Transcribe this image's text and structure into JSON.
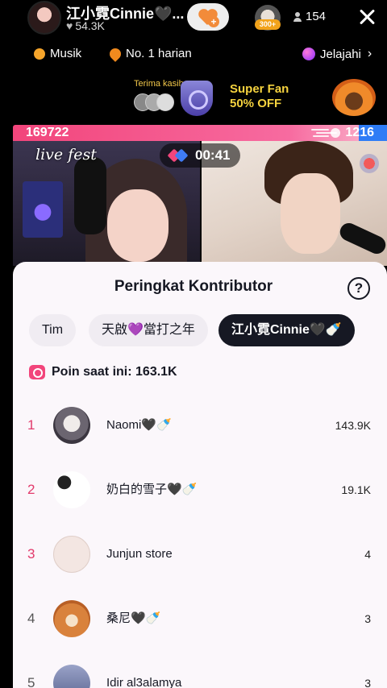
{
  "host": {
    "name": "江小霓Cinnie🖤...",
    "likes": "54.3K"
  },
  "gift": {
    "badge": "300+"
  },
  "viewers": "154",
  "chips": {
    "music": "Musik",
    "rank": "No. 1 harian",
    "explore": "Jelajahi"
  },
  "promo": {
    "thanks": "Terima kasih",
    "title": "Super Fan",
    "subtitle": "50% OFF"
  },
  "battle": {
    "left_score": "169722",
    "right_score": "1216",
    "left_share": 0.925,
    "overlay_text": "live fest",
    "timer": "00:41"
  },
  "sheet": {
    "title": "Peringkat Kontributor",
    "tabs": [
      "Tim",
      "天啟💜當打之年",
      "江小霓Cinnie🖤🍼"
    ],
    "points_label": "Poin saat ini: 163.1K",
    "contributors": [
      {
        "rank": "1",
        "name": "Naomi🖤🍼",
        "score": "143.9K"
      },
      {
        "rank": "2",
        "name": "奶白的雪子🖤🍼",
        "score": "19.1K"
      },
      {
        "rank": "3",
        "name": "Junjun store",
        "score": "4"
      },
      {
        "rank": "4",
        "name": "桑尼🖤🍼",
        "score": "3"
      },
      {
        "rank": "5",
        "name": "Idir al3alamya",
        "score": "3"
      }
    ]
  },
  "colors": {
    "accent_pink": "#f2457b",
    "accent_blue": "#2e7cf6",
    "rank_top": "#e23a6b"
  }
}
